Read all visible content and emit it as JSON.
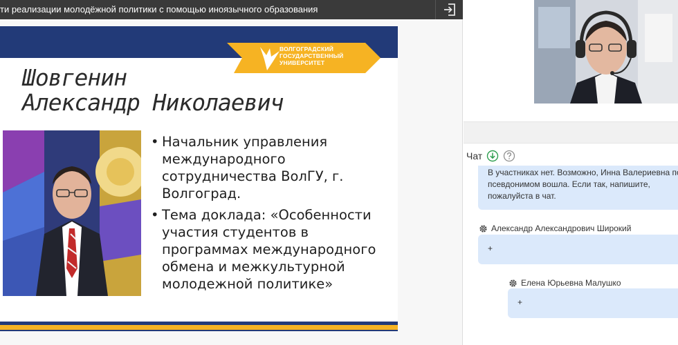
{
  "topbar": {
    "title": "ти реализации молодёжной политики с помощью иноязычного образования",
    "exit_icon": "exit-icon"
  },
  "slide": {
    "university": [
      "ВОЛГОГРАДСКИЙ",
      "ГОСУДАРСТВЕННЫЙ",
      "УНИВЕРСИТЕТ"
    ],
    "speaker_name": [
      "Шовгенин",
      "Александр Николаевич"
    ],
    "bullets": [
      "Начальник управления международного сотрудничества ВолГУ, г. Волгоград.",
      "Тема доклада: «Особенности участия студентов в программах международного обмена и межкультурной молодежной политике»"
    ],
    "colors": {
      "brand_blue": "#223a78",
      "brand_gold": "#f6b323"
    }
  },
  "chat": {
    "title": "Чат",
    "download_icon": "download-icon",
    "help_icon": "help-icon",
    "messages": [
      {
        "lines": [
          "В участниках нет. Возможно, Инна Валериевна по",
          "псевдонимом вошла. Если так, напишите,",
          "пожалуйста в чат."
        ]
      },
      {
        "sender": "Александр Александрович Широкий",
        "text": "+"
      },
      {
        "sender": "Елена Юрьевна Малушко",
        "text": "+"
      }
    ],
    "bubble_color": "#dbe9fb"
  }
}
